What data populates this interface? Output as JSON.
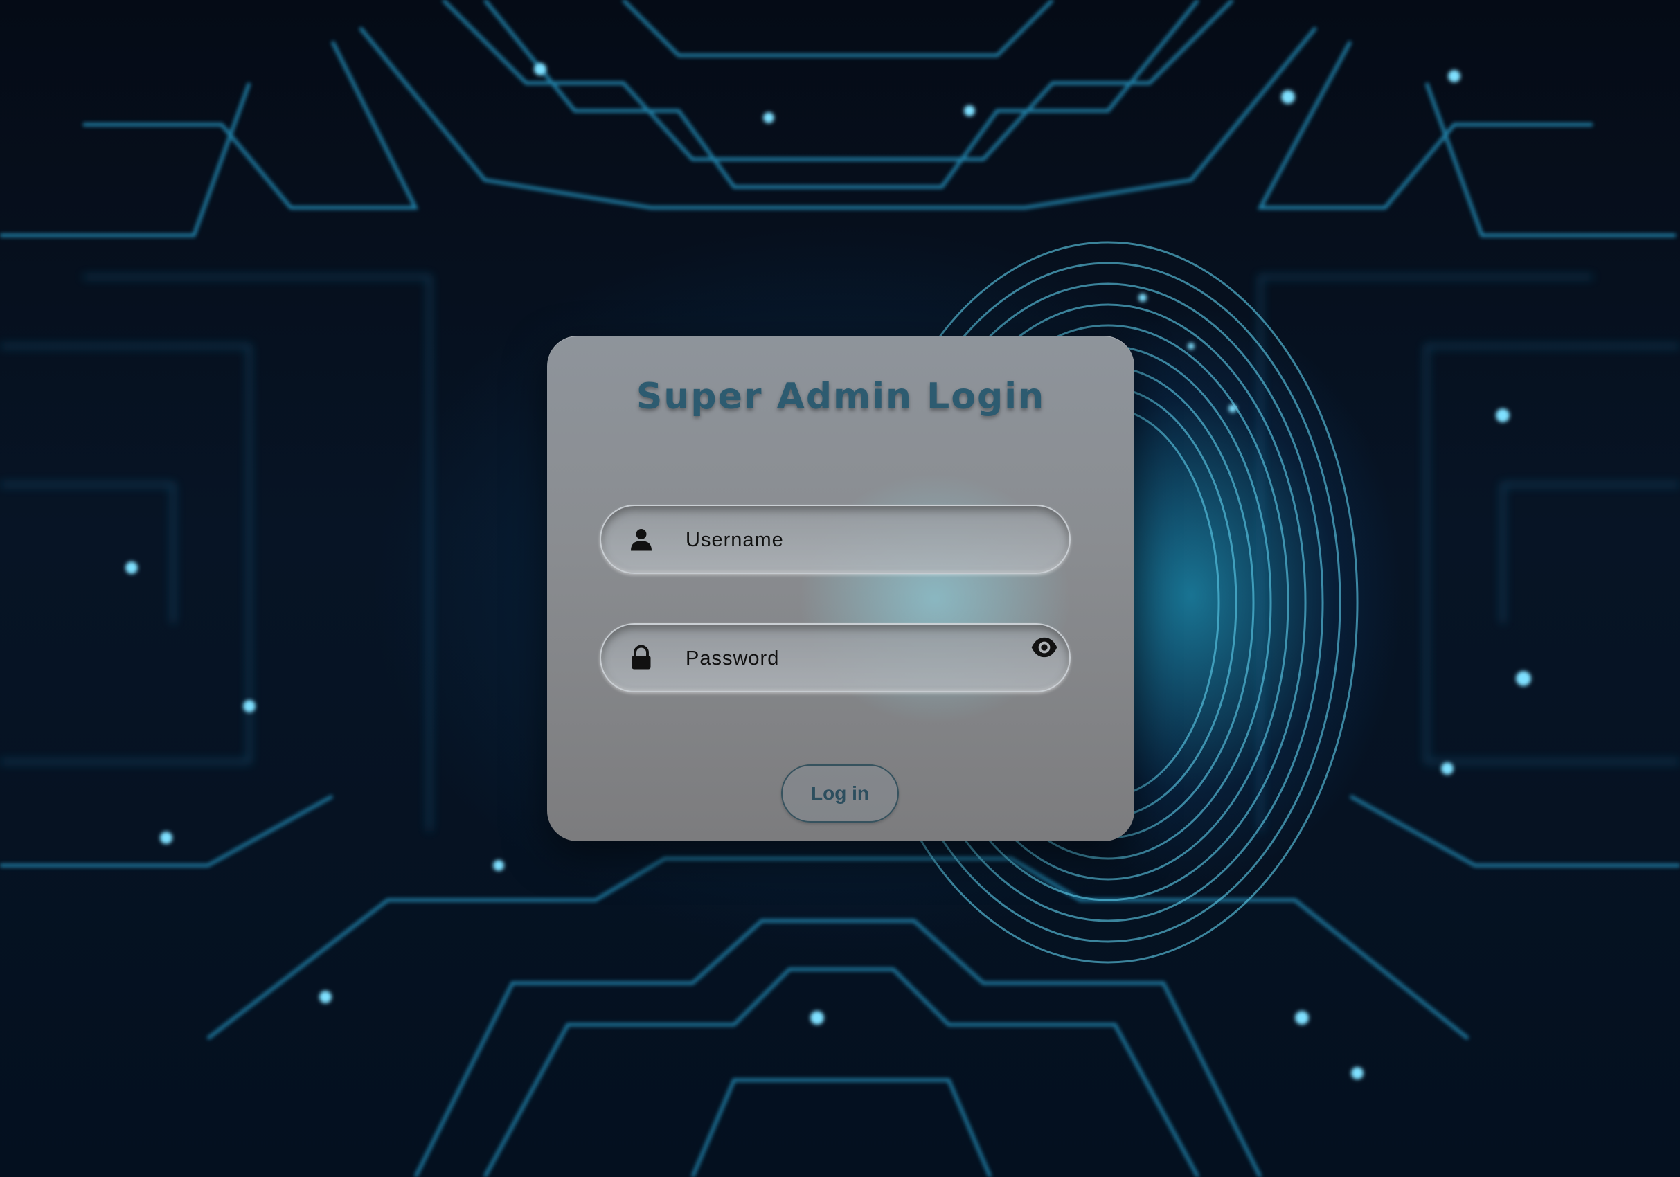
{
  "login": {
    "title": "Super Admin Login",
    "username_placeholder": "Username",
    "password_placeholder": "Password",
    "submit_label": "Log in"
  },
  "icons": {
    "username": "user-icon",
    "password": "lock-icon",
    "toggle": "eye-icon"
  },
  "colors": {
    "title": "#2d5b70",
    "button_text": "#2c4e5e",
    "background": "#050b16",
    "accent_glow": "#28bee6"
  }
}
